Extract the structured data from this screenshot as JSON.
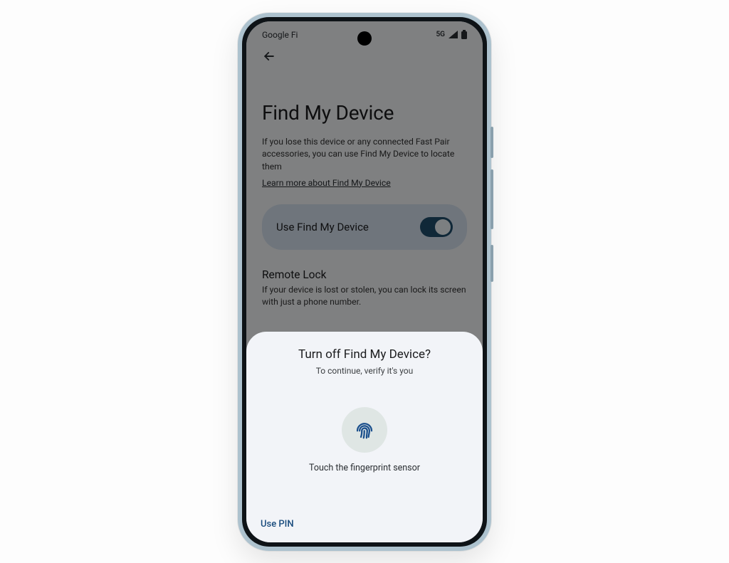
{
  "statusbar": {
    "carrier": "Google Fi",
    "network": "5G"
  },
  "page": {
    "title": "Find My Device",
    "description": "If you lose this device or any connected Fast Pair accessories, you can use Find My Device to locate them",
    "learn_more": "Learn more about Find My Device",
    "toggle_label": "Use Find My Device",
    "toggle_on": true,
    "remote_lock_title": "Remote Lock",
    "remote_lock_desc": "If your device is lost or stolen, you can lock its screen with just a phone number."
  },
  "sheet": {
    "title": "Turn off Find My Device?",
    "subtitle": "To continue, verify it's you",
    "fp_caption": "Touch the fingerprint sensor",
    "alt_action": "Use PIN"
  }
}
